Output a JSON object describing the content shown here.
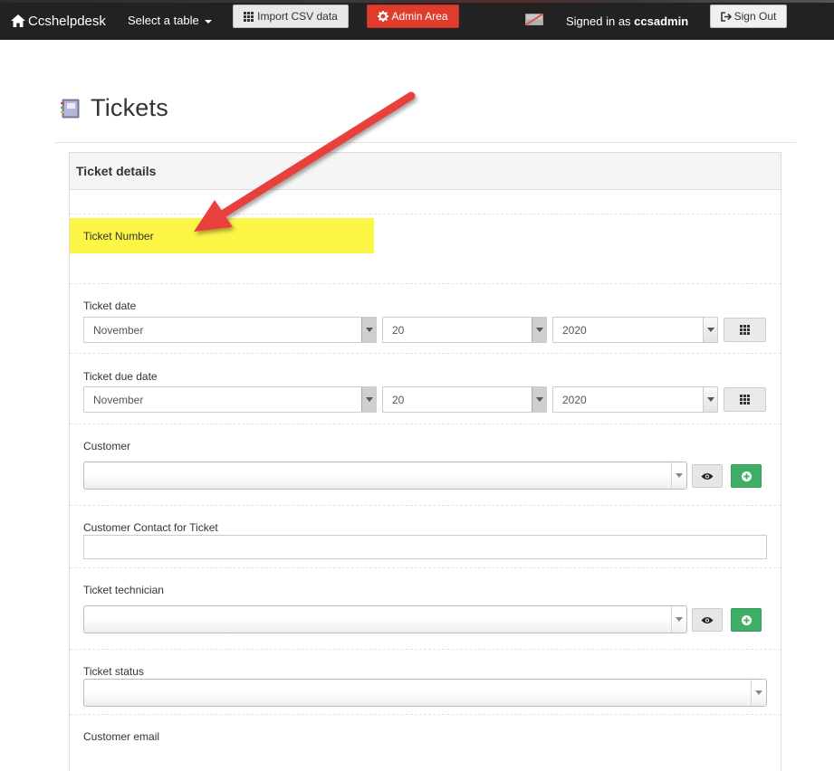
{
  "navbar": {
    "brand": "Ccshelpdesk",
    "select_table": "Select a table",
    "import_csv": "Import CSV data",
    "admin_area": "Admin Area",
    "signed_in_prefix": "Signed in as ",
    "username": "ccsadmin",
    "sign_out": "Sign Out"
  },
  "page": {
    "title": "Tickets",
    "icon": "address-book-icon"
  },
  "panel": {
    "heading": "Ticket details",
    "fields": {
      "ticket_number": {
        "label": "Ticket Number"
      },
      "ticket_date": {
        "label": "Ticket date",
        "month": "November",
        "day": "20",
        "year": "2020"
      },
      "ticket_due_date": {
        "label": "Ticket due date",
        "month": "November",
        "day": "20",
        "year": "2020"
      },
      "customer": {
        "label": "Customer",
        "value": ""
      },
      "customer_contact": {
        "label": "Customer Contact for Ticket",
        "value": ""
      },
      "ticket_technician": {
        "label": "Ticket technician",
        "value": ""
      },
      "ticket_status": {
        "label": "Ticket status",
        "value": ""
      },
      "customer_email": {
        "label": "Customer email"
      }
    }
  },
  "annotation": {
    "highlight_color": "#fbf546",
    "arrow_color": "#e8403a"
  },
  "colors": {
    "navbar_bg": "#222222",
    "admin_button": "#e03c2c",
    "add_button": "#3fae67"
  }
}
